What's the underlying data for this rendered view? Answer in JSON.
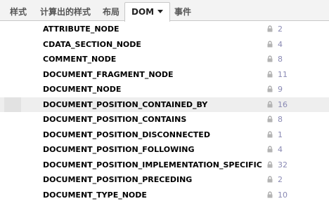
{
  "tabs": [
    {
      "label": "样式",
      "active": false
    },
    {
      "label": "计算出的样式",
      "active": false
    },
    {
      "label": "布局",
      "active": false
    },
    {
      "label": "DOM",
      "active": true
    },
    {
      "label": "事件",
      "active": false
    }
  ],
  "rows": [
    {
      "name": "ATTRIBUTE_NODE",
      "value": "2"
    },
    {
      "name": "CDATA_SECTION_NODE",
      "value": "4"
    },
    {
      "name": "COMMENT_NODE",
      "value": "8"
    },
    {
      "name": "DOCUMENT_FRAGMENT_NODE",
      "value": "11"
    },
    {
      "name": "DOCUMENT_NODE",
      "value": "9"
    },
    {
      "name": "DOCUMENT_POSITION_CONTAINED_BY",
      "value": "16"
    },
    {
      "name": "DOCUMENT_POSITION_CONTAINS",
      "value": "8"
    },
    {
      "name": "DOCUMENT_POSITION_DISCONNECTED",
      "value": "1"
    },
    {
      "name": "DOCUMENT_POSITION_FOLLOWING",
      "value": "4"
    },
    {
      "name": "DOCUMENT_POSITION_IMPLEMENTATION_SPECIFIC",
      "value": "32"
    },
    {
      "name": "DOCUMENT_POSITION_PRECEDING",
      "value": "2"
    },
    {
      "name": "DOCUMENT_TYPE_NODE",
      "value": "10"
    }
  ],
  "hovered_row": "DOCUMENT_POSITION_CONTAINED_BY",
  "row_icon": "lock-icon",
  "colors": {
    "value_text": "#8a8ab4",
    "tabbar_bg": "#f3f3f3",
    "hover_bg": "#eeeeee"
  }
}
